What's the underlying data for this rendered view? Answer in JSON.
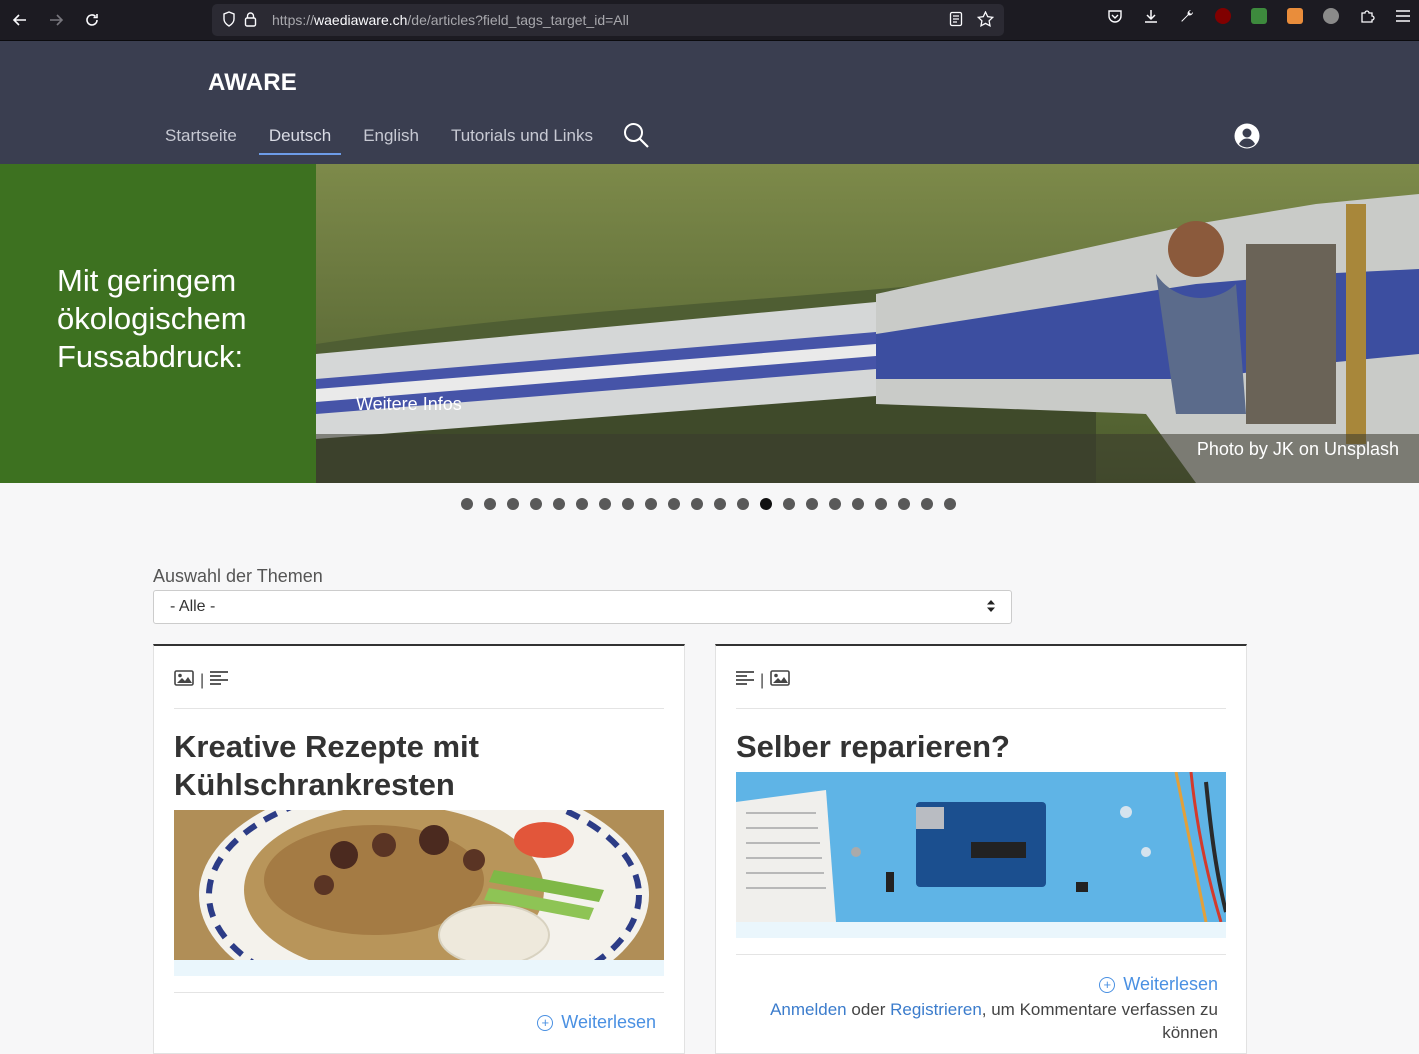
{
  "browser": {
    "url_prefix": "https://",
    "url_host": "waediaware.ch",
    "url_path": "/de/articles?field_tags_target_id=All"
  },
  "site": {
    "brand": "AWARE",
    "nav": [
      {
        "label": "Startseite"
      },
      {
        "label": "Deutsch"
      },
      {
        "label": "English"
      },
      {
        "label": "Tutorials und Links"
      }
    ]
  },
  "hero": {
    "title": "Mit geringem ökologischem Fussabdruck:",
    "more": "Weitere Infos",
    "credit": "Photo by JK on Unsplash",
    "slide_count": 22,
    "active_slide": 14
  },
  "filter": {
    "label": "Auswahl der Themen",
    "selected": "- Alle -"
  },
  "cards": [
    {
      "title": "Kreative Rezepte mit Kühlschrankresten",
      "read_more": "Weiterlesen"
    },
    {
      "title": "Selber reparieren?",
      "read_more": "Weiterlesen",
      "login": "Anmelden",
      "or": "oder",
      "register": "Registrieren",
      "suffix": ", um Kommentare verfassen zu können"
    }
  ]
}
